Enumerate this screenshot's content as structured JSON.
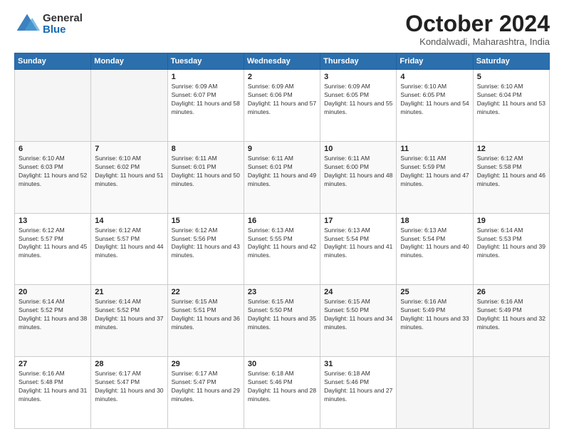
{
  "logo": {
    "general": "General",
    "blue": "Blue"
  },
  "title": "October 2024",
  "location": "Kondalwadi, Maharashtra, India",
  "days_of_week": [
    "Sunday",
    "Monday",
    "Tuesday",
    "Wednesday",
    "Thursday",
    "Friday",
    "Saturday"
  ],
  "weeks": [
    [
      {
        "day": "",
        "info": ""
      },
      {
        "day": "",
        "info": ""
      },
      {
        "day": "1",
        "info": "Sunrise: 6:09 AM\nSunset: 6:07 PM\nDaylight: 11 hours and 58 minutes."
      },
      {
        "day": "2",
        "info": "Sunrise: 6:09 AM\nSunset: 6:06 PM\nDaylight: 11 hours and 57 minutes."
      },
      {
        "day": "3",
        "info": "Sunrise: 6:09 AM\nSunset: 6:05 PM\nDaylight: 11 hours and 55 minutes."
      },
      {
        "day": "4",
        "info": "Sunrise: 6:10 AM\nSunset: 6:05 PM\nDaylight: 11 hours and 54 minutes."
      },
      {
        "day": "5",
        "info": "Sunrise: 6:10 AM\nSunset: 6:04 PM\nDaylight: 11 hours and 53 minutes."
      }
    ],
    [
      {
        "day": "6",
        "info": "Sunrise: 6:10 AM\nSunset: 6:03 PM\nDaylight: 11 hours and 52 minutes."
      },
      {
        "day": "7",
        "info": "Sunrise: 6:10 AM\nSunset: 6:02 PM\nDaylight: 11 hours and 51 minutes."
      },
      {
        "day": "8",
        "info": "Sunrise: 6:11 AM\nSunset: 6:01 PM\nDaylight: 11 hours and 50 minutes."
      },
      {
        "day": "9",
        "info": "Sunrise: 6:11 AM\nSunset: 6:01 PM\nDaylight: 11 hours and 49 minutes."
      },
      {
        "day": "10",
        "info": "Sunrise: 6:11 AM\nSunset: 6:00 PM\nDaylight: 11 hours and 48 minutes."
      },
      {
        "day": "11",
        "info": "Sunrise: 6:11 AM\nSunset: 5:59 PM\nDaylight: 11 hours and 47 minutes."
      },
      {
        "day": "12",
        "info": "Sunrise: 6:12 AM\nSunset: 5:58 PM\nDaylight: 11 hours and 46 minutes."
      }
    ],
    [
      {
        "day": "13",
        "info": "Sunrise: 6:12 AM\nSunset: 5:57 PM\nDaylight: 11 hours and 45 minutes."
      },
      {
        "day": "14",
        "info": "Sunrise: 6:12 AM\nSunset: 5:57 PM\nDaylight: 11 hours and 44 minutes."
      },
      {
        "day": "15",
        "info": "Sunrise: 6:12 AM\nSunset: 5:56 PM\nDaylight: 11 hours and 43 minutes."
      },
      {
        "day": "16",
        "info": "Sunrise: 6:13 AM\nSunset: 5:55 PM\nDaylight: 11 hours and 42 minutes."
      },
      {
        "day": "17",
        "info": "Sunrise: 6:13 AM\nSunset: 5:54 PM\nDaylight: 11 hours and 41 minutes."
      },
      {
        "day": "18",
        "info": "Sunrise: 6:13 AM\nSunset: 5:54 PM\nDaylight: 11 hours and 40 minutes."
      },
      {
        "day": "19",
        "info": "Sunrise: 6:14 AM\nSunset: 5:53 PM\nDaylight: 11 hours and 39 minutes."
      }
    ],
    [
      {
        "day": "20",
        "info": "Sunrise: 6:14 AM\nSunset: 5:52 PM\nDaylight: 11 hours and 38 minutes."
      },
      {
        "day": "21",
        "info": "Sunrise: 6:14 AM\nSunset: 5:52 PM\nDaylight: 11 hours and 37 minutes."
      },
      {
        "day": "22",
        "info": "Sunrise: 6:15 AM\nSunset: 5:51 PM\nDaylight: 11 hours and 36 minutes."
      },
      {
        "day": "23",
        "info": "Sunrise: 6:15 AM\nSunset: 5:50 PM\nDaylight: 11 hours and 35 minutes."
      },
      {
        "day": "24",
        "info": "Sunrise: 6:15 AM\nSunset: 5:50 PM\nDaylight: 11 hours and 34 minutes."
      },
      {
        "day": "25",
        "info": "Sunrise: 6:16 AM\nSunset: 5:49 PM\nDaylight: 11 hours and 33 minutes."
      },
      {
        "day": "26",
        "info": "Sunrise: 6:16 AM\nSunset: 5:49 PM\nDaylight: 11 hours and 32 minutes."
      }
    ],
    [
      {
        "day": "27",
        "info": "Sunrise: 6:16 AM\nSunset: 5:48 PM\nDaylight: 11 hours and 31 minutes."
      },
      {
        "day": "28",
        "info": "Sunrise: 6:17 AM\nSunset: 5:47 PM\nDaylight: 11 hours and 30 minutes."
      },
      {
        "day": "29",
        "info": "Sunrise: 6:17 AM\nSunset: 5:47 PM\nDaylight: 11 hours and 29 minutes."
      },
      {
        "day": "30",
        "info": "Sunrise: 6:18 AM\nSunset: 5:46 PM\nDaylight: 11 hours and 28 minutes."
      },
      {
        "day": "31",
        "info": "Sunrise: 6:18 AM\nSunset: 5:46 PM\nDaylight: 11 hours and 27 minutes."
      },
      {
        "day": "",
        "info": ""
      },
      {
        "day": "",
        "info": ""
      }
    ]
  ]
}
